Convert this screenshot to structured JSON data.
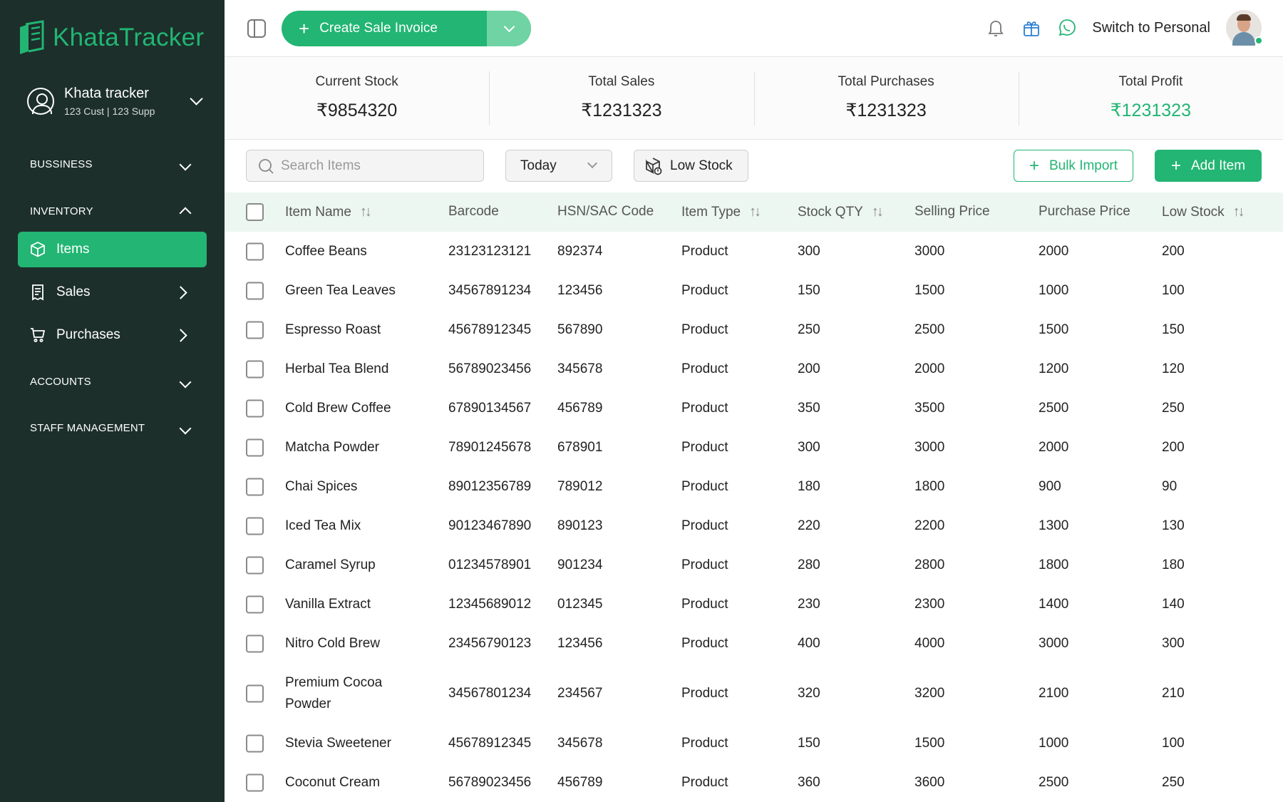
{
  "brand": {
    "name": "KhataTracker",
    "accent_color": "#22b573",
    "sidebar_color": "#1c2f2b"
  },
  "sidebar": {
    "profile": {
      "name": "Khata tracker",
      "sub": "123 Cust | 123 Supp"
    },
    "sections": {
      "business": "BUSSINESS",
      "inventory": "INVENTORY",
      "accounts": "ACCOUNTS",
      "staff": "STAFF MANAGEMENT"
    },
    "items": {
      "items": "Items",
      "sales": "Sales",
      "purchases": "Purchases"
    }
  },
  "topbar": {
    "create_label": "Create Sale Invoice",
    "switch_label": "Switch to Personal"
  },
  "stats": {
    "current_stock": {
      "label": "Current Stock",
      "value": "₹9854320"
    },
    "total_sales": {
      "label": "Total Sales",
      "value": "₹1231323"
    },
    "total_purchases": {
      "label": "Total Purchases",
      "value": "₹1231323"
    },
    "total_profit": {
      "label": "Total Profit",
      "value": "₹1231323"
    }
  },
  "filters": {
    "search_placeholder": "Search Items",
    "period": "Today",
    "low_stock": "Low Stock",
    "bulk_import": "Bulk Import",
    "add_item": "Add Item"
  },
  "table": {
    "columns": {
      "name": "Item Name",
      "barcode": "Barcode",
      "hsn": "HSN/SAC Code",
      "type": "Item Type",
      "stock": "Stock QTY",
      "selling": "Selling Price",
      "purchase": "Purchase Price",
      "low": "Low Stock"
    },
    "rows": [
      {
        "name": "Coffee Beans",
        "barcode": "23123123121",
        "hsn": "892374",
        "type": "Product",
        "stock": "300",
        "selling": "3000",
        "purchase": "2000",
        "low": "200"
      },
      {
        "name": "Green Tea Leaves",
        "barcode": "34567891234",
        "hsn": "123456",
        "type": "Product",
        "stock": "150",
        "selling": "1500",
        "purchase": "1000",
        "low": "100"
      },
      {
        "name": "Espresso Roast",
        "barcode": "45678912345",
        "hsn": "567890",
        "type": "Product",
        "stock": "250",
        "selling": "2500",
        "purchase": "1500",
        "low": "150"
      },
      {
        "name": "Herbal Tea Blend",
        "barcode": "56789023456",
        "hsn": "345678",
        "type": "Product",
        "stock": "200",
        "selling": "2000",
        "purchase": "1200",
        "low": "120"
      },
      {
        "name": "Cold Brew Coffee",
        "barcode": "67890134567",
        "hsn": "456789",
        "type": "Product",
        "stock": "350",
        "selling": "3500",
        "purchase": "2500",
        "low": "250"
      },
      {
        "name": "Matcha Powder",
        "barcode": "78901245678",
        "hsn": "678901",
        "type": "Product",
        "stock": "300",
        "selling": "3000",
        "purchase": "2000",
        "low": "200"
      },
      {
        "name": "Chai Spices",
        "barcode": "89012356789",
        "hsn": "789012",
        "type": "Product",
        "stock": "180",
        "selling": "1800",
        "purchase": "900",
        "low": "90"
      },
      {
        "name": "Iced Tea Mix",
        "barcode": "90123467890",
        "hsn": "890123",
        "type": "Product",
        "stock": "220",
        "selling": "2200",
        "purchase": "1300",
        "low": "130"
      },
      {
        "name": "Caramel Syrup",
        "barcode": "01234578901",
        "hsn": "901234",
        "type": "Product",
        "stock": "280",
        "selling": "2800",
        "purchase": "1800",
        "low": "180"
      },
      {
        "name": "Vanilla Extract",
        "barcode": "12345689012",
        "hsn": "012345",
        "type": "Product",
        "stock": "230",
        "selling": "2300",
        "purchase": "1400",
        "low": "140"
      },
      {
        "name": "Nitro Cold Brew",
        "barcode": "23456790123",
        "hsn": "123456",
        "type": "Product",
        "stock": "400",
        "selling": "4000",
        "purchase": "3000",
        "low": "300"
      },
      {
        "name": "Premium Cocoa Powder",
        "barcode": "34567801234",
        "hsn": "234567",
        "type": "Product",
        "stock": "320",
        "selling": "3200",
        "purchase": "2100",
        "low": "210"
      },
      {
        "name": "Stevia Sweetener",
        "barcode": "45678912345",
        "hsn": "345678",
        "type": "Product",
        "stock": "150",
        "selling": "1500",
        "purchase": "1000",
        "low": "100"
      },
      {
        "name": "Coconut Cream",
        "barcode": "56789023456",
        "hsn": "456789",
        "type": "Product",
        "stock": "360",
        "selling": "3600",
        "purchase": "2500",
        "low": "250"
      }
    ]
  }
}
